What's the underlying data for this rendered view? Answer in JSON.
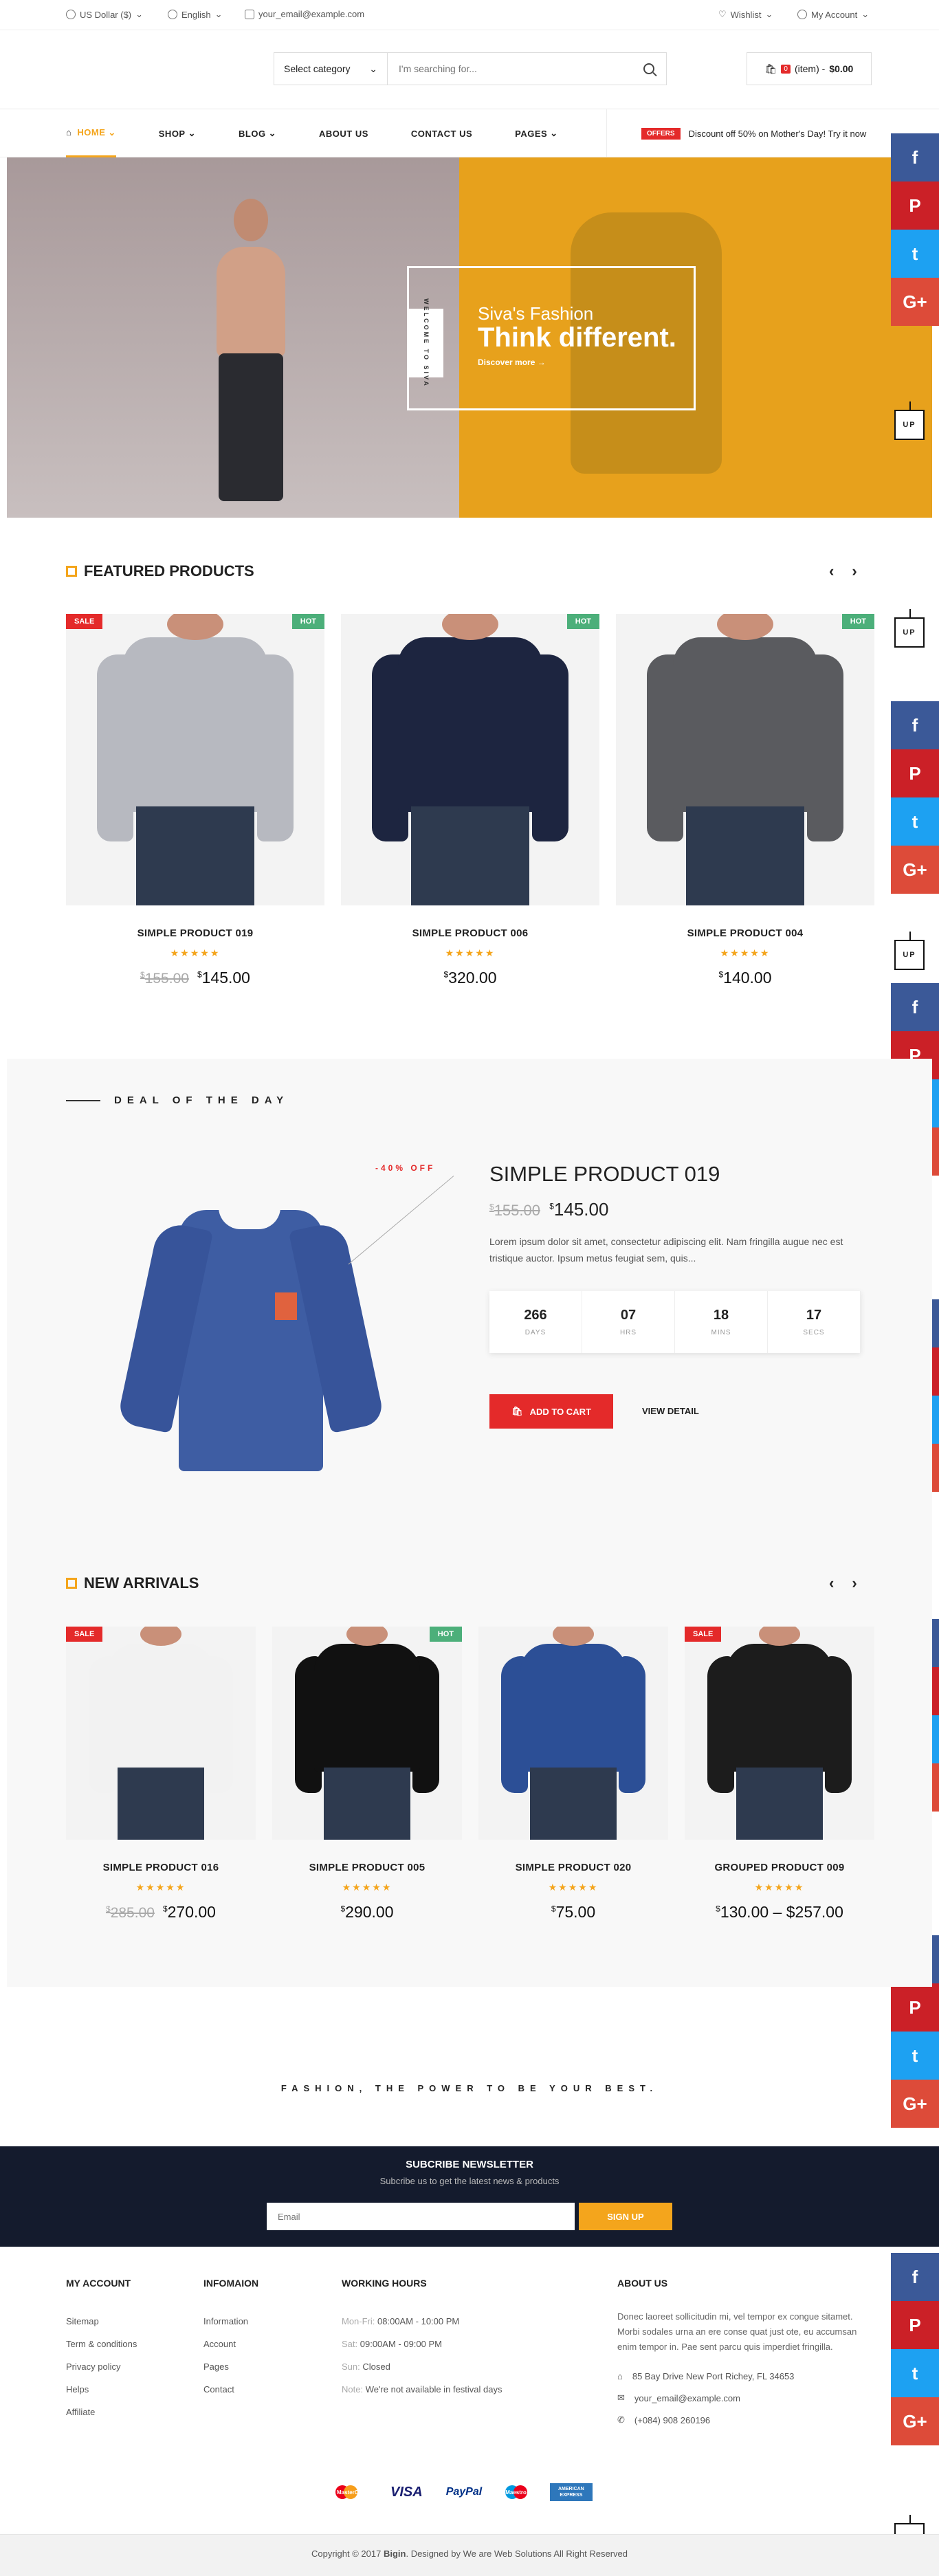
{
  "topbar": {
    "currency": "US Dollar ($)",
    "language": "English",
    "email": "your_email@example.com",
    "wishlist": "Wishlist",
    "account": "My Account"
  },
  "header": {
    "category": "Select category",
    "search_placeholder": "I'm searching for...",
    "cart_count": "0",
    "cart_label": "(item) -",
    "cart_total": "$0.00"
  },
  "nav": {
    "items": [
      "HOME",
      "SHOP",
      "BLOG",
      "ABOUT US",
      "CONTACT US",
      "PAGES"
    ],
    "offer_tag": "OFFERS",
    "offer_text": "Discount off 50% on Mother's Day! Try it now"
  },
  "hero": {
    "welcome": "WELCOME TO SIVA",
    "subtitle": "Siva's Fashion",
    "title": "Think different.",
    "cta": "Discover more →"
  },
  "social": [
    "f",
    "P",
    "t",
    "G+"
  ],
  "up_label": "UP",
  "featured": {
    "title": "FEATURED PRODUCTS",
    "products": [
      {
        "name": "SIMPLE PRODUCT 019",
        "old": "155.00",
        "price": "145.00",
        "sale": "SALE",
        "hot": "HOT",
        "shirt": "#b7b9c0"
      },
      {
        "name": "SIMPLE PRODUCT 006",
        "old": "",
        "price": "320.00",
        "sale": "",
        "hot": "HOT",
        "shirt": "#1d2540"
      },
      {
        "name": "SIMPLE PRODUCT 004",
        "old": "",
        "price": "140.00",
        "sale": "",
        "hot": "HOT",
        "shirt": "#5a5b5f"
      }
    ]
  },
  "deal": {
    "title": "DEAL OF THE DAY",
    "discount": "-40% OFF",
    "name": "SIMPLE PRODUCT 019",
    "old": "155.00",
    "price": "145.00",
    "desc": "Lorem ipsum dolor sit amet, consectetur adipiscing elit. Nam fringilla augue nec est tristique auctor. Ipsum metus feugiat sem, quis...",
    "countdown": [
      {
        "v": "266",
        "l": "DAYS"
      },
      {
        "v": "07",
        "l": "HRS"
      },
      {
        "v": "18",
        "l": "MINS"
      },
      {
        "v": "17",
        "l": "SECS"
      }
    ],
    "add_to_cart": "ADD TO CART",
    "view_detail": "VIEW DETAIL"
  },
  "arrivals": {
    "title": "NEW ARRIVALS",
    "products": [
      {
        "name": "SIMPLE PRODUCT 016",
        "old": "285.00",
        "price": "270.00",
        "sale": "SALE",
        "hot": "",
        "shirt": "#f2f2f2"
      },
      {
        "name": "SIMPLE PRODUCT 005",
        "old": "",
        "price": "290.00",
        "sale": "",
        "hot": "HOT",
        "shirt": "#111"
      },
      {
        "name": "SIMPLE PRODUCT 020",
        "old": "",
        "price": "75.00",
        "sale": "",
        "hot": "",
        "shirt": "#2c4f96"
      },
      {
        "name": "GROUPED PRODUCT 009",
        "old": "",
        "price": "130.00 – $257.00",
        "sale": "SALE",
        "hot": "",
        "shirt": "#1c1c1c"
      }
    ]
  },
  "tagline": "FASHION, THE POWER TO BE YOUR BEST.",
  "newsletter": {
    "title": "SUBCRIBE NEWSLETTER",
    "subtitle": "Subcribe us to get the latest news & products",
    "placeholder": "Email",
    "button": "SIGN UP"
  },
  "footer": {
    "account": {
      "title": "MY ACCOUNT",
      "links": [
        "Sitemap",
        "Term & conditions",
        "Privacy policy",
        "Helps",
        "Affiliate"
      ]
    },
    "info": {
      "title": "INFOMAION",
      "links": [
        "Information",
        "Account",
        "Pages",
        "Contact"
      ]
    },
    "hours": {
      "title": "WORKING HOURS",
      "rows": [
        {
          "k": "Mon-Fri:",
          "v": "08:00AM - 10:00 PM"
        },
        {
          "k": "Sat:",
          "v": "09:00AM - 09:00 PM"
        },
        {
          "k": "Sun:",
          "v": "Closed"
        },
        {
          "k": "Note:",
          "v": "We're not available in festival days"
        }
      ]
    },
    "about": {
      "title": "ABOUT US",
      "text": "Donec laoreet sollicitudin mi, vel tempor ex congue sitamet. Morbi sodales urna an ere conse quat just ote, eu accumsan enim tempor in. Pae sent parcu quis imperdiet fringilla.",
      "address": "85 Bay Drive New Port Richey, FL 34653",
      "email": "your_email@example.com",
      "phone": "(+084) 908 260196"
    },
    "payments": [
      "MasterCard",
      "VISA",
      "PayPal",
      "Maestro",
      "AMERICAN EXPRESS"
    ],
    "copyright_pre": "Copyright © 2017",
    "copyright_brand": "Bigin",
    "copyright_post": ". Designed by We are Web Solutions All Right Reserved"
  },
  "colors": {
    "accent": "#f4a51c",
    "sale": "#e42a2a",
    "hot": "#4caf7a",
    "dark": "#141b2d"
  }
}
